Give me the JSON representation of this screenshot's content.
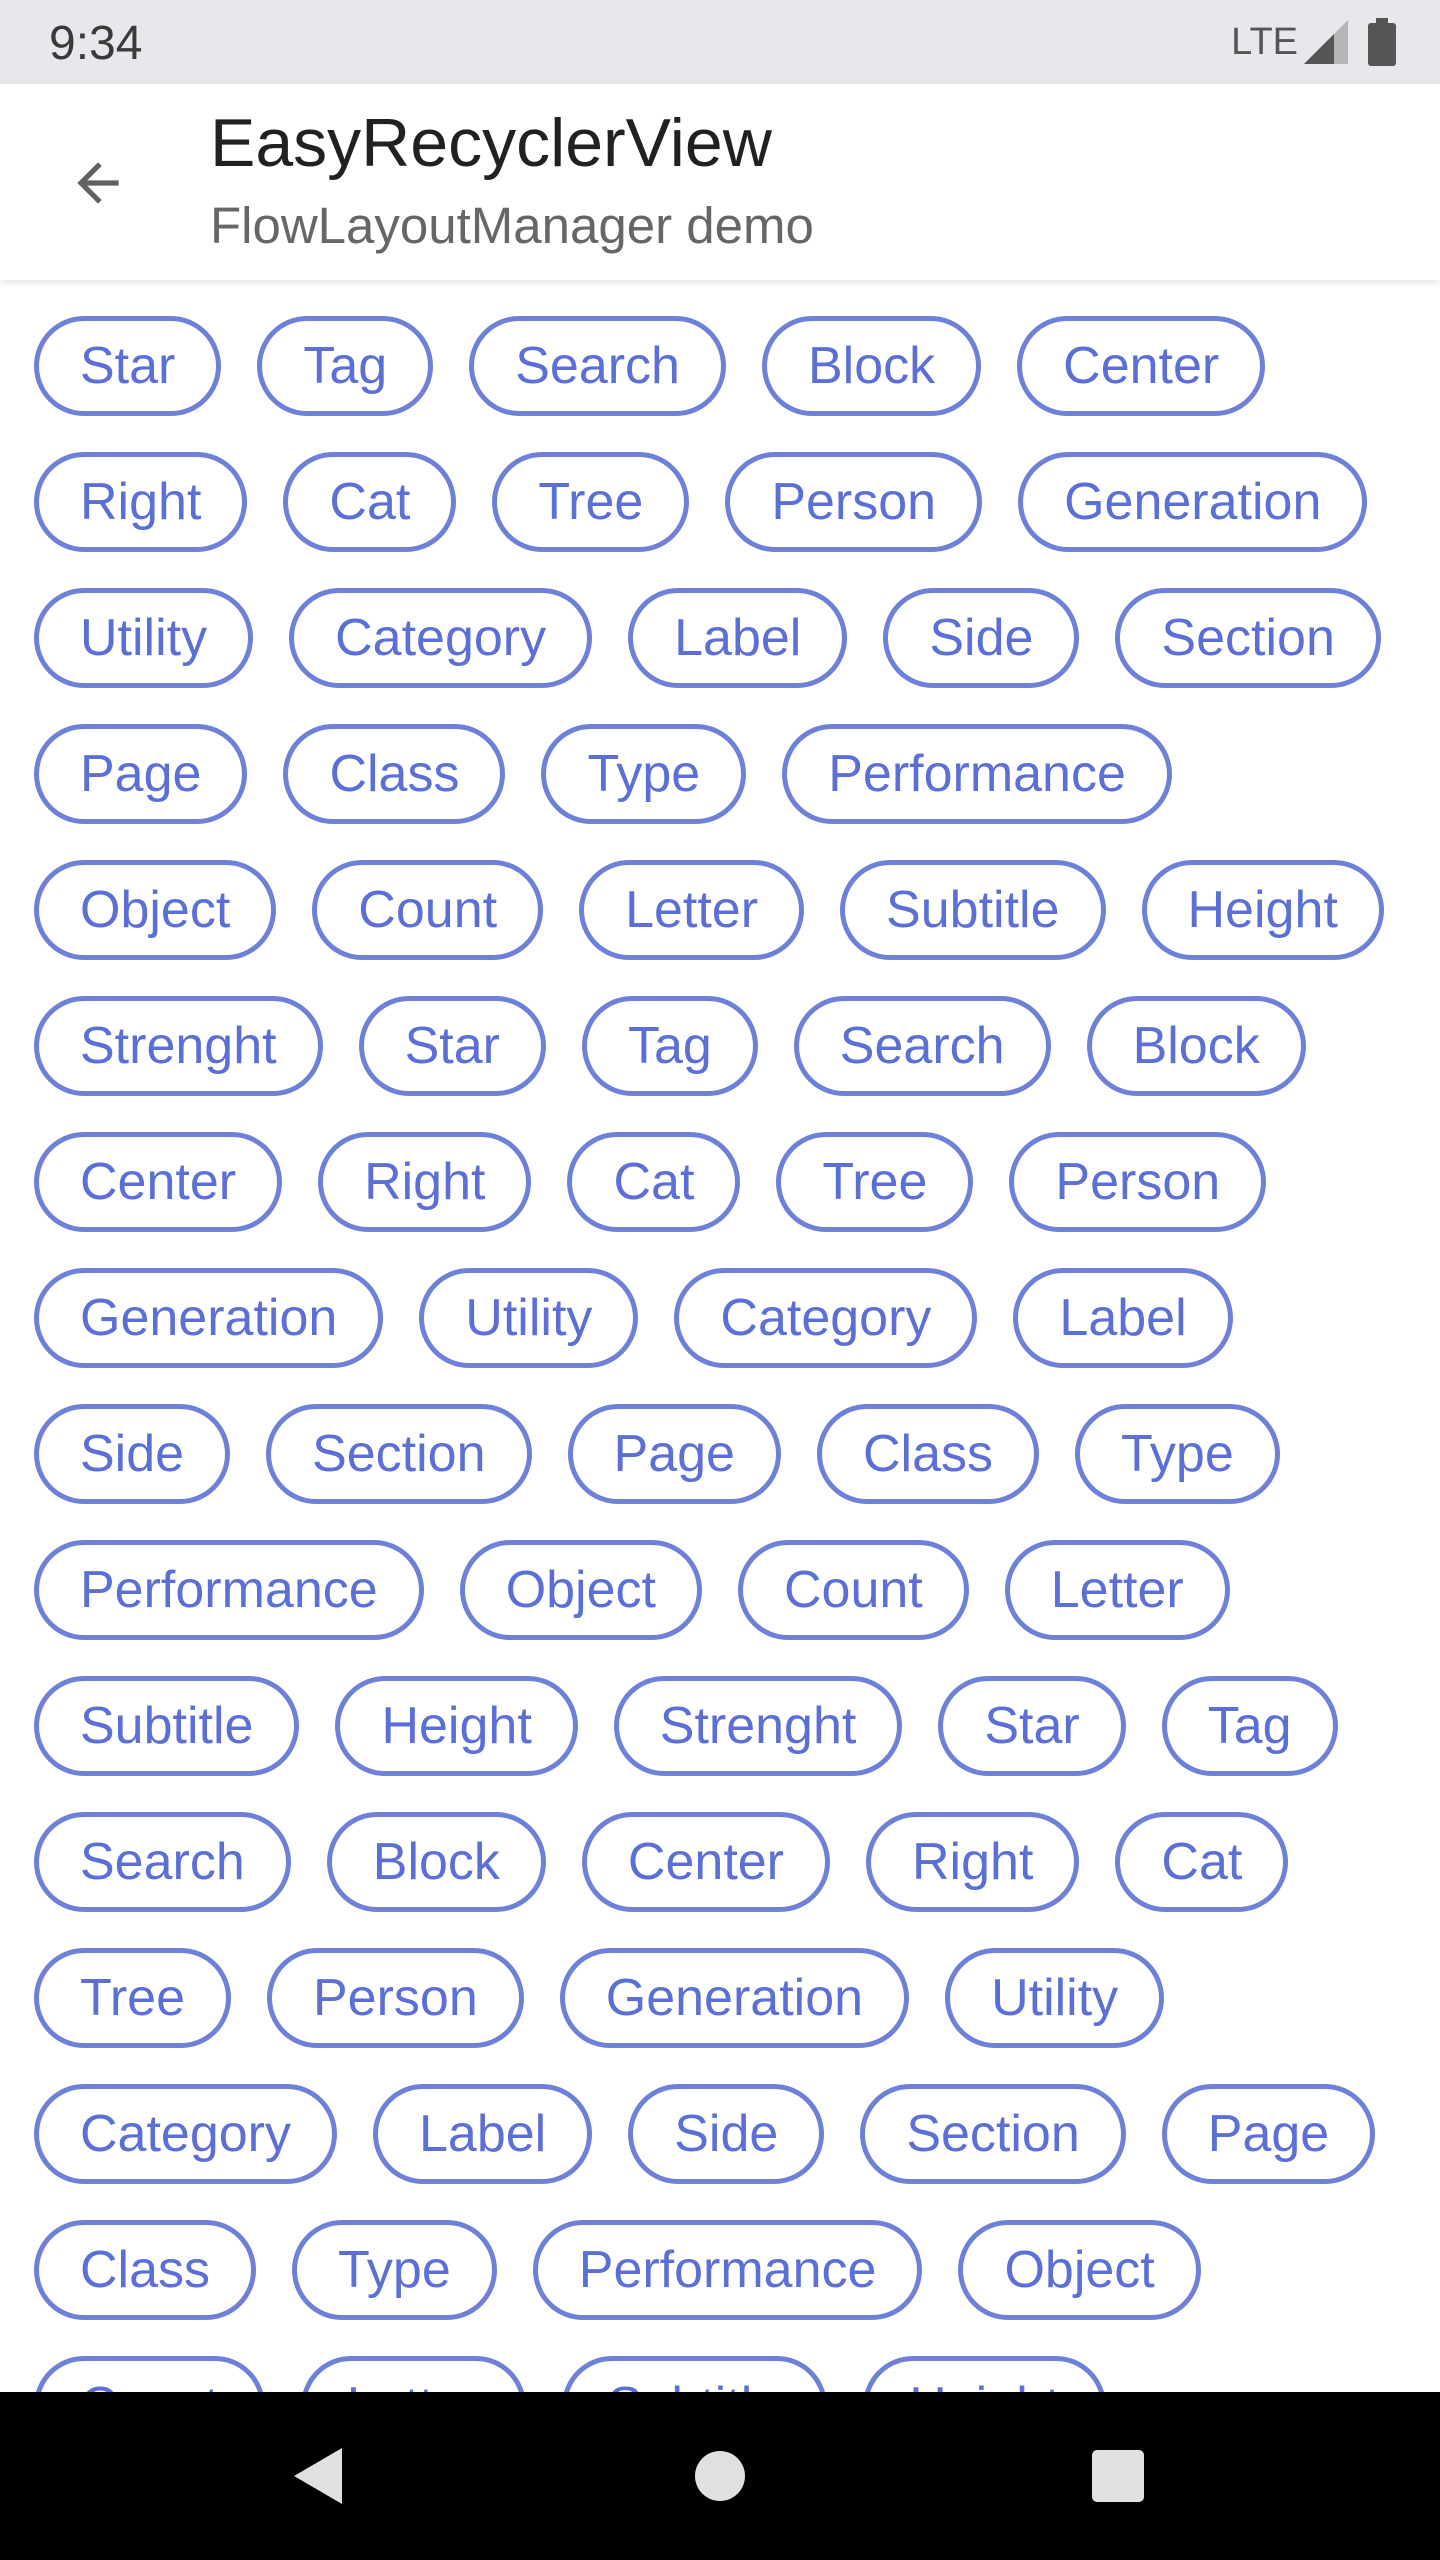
{
  "status_bar": {
    "time": "9:34",
    "network": "LTE"
  },
  "app_bar": {
    "title": "EasyRecyclerView",
    "subtitle": "FlowLayoutManager demo",
    "back_icon": "arrow-back-icon"
  },
  "colors": {
    "accent": "#5c6fd6",
    "tag_border": "#6f80d8",
    "status_bar_bg": "#e8e8ec",
    "nav_bar_bg": "#000000"
  },
  "tag_rows": [
    [
      "Star",
      "Tag",
      "Search",
      "Block",
      "Center"
    ],
    [
      "Right",
      "Cat",
      "Tree",
      "Person",
      "Generation"
    ],
    [
      "Utility",
      "Category",
      "Label",
      "Side",
      "Section"
    ],
    [
      "Page",
      "Class",
      "Type",
      "Performance"
    ],
    [
      "Object",
      "Count",
      "Letter",
      "Subtitle",
      "Height"
    ],
    [
      "Strenght",
      "Star",
      "Tag",
      "Search",
      "Block"
    ],
    [
      "Center",
      "Right",
      "Cat",
      "Tree",
      "Person"
    ],
    [
      "Generation",
      "Utility",
      "Category",
      "Label"
    ],
    [
      "Side",
      "Section",
      "Page",
      "Class",
      "Type"
    ],
    [
      "Performance",
      "Object",
      "Count",
      "Letter"
    ],
    [
      "Subtitle",
      "Height",
      "Strenght",
      "Star",
      "Tag"
    ],
    [
      "Search",
      "Block",
      "Center",
      "Right",
      "Cat"
    ],
    [
      "Tree",
      "Person",
      "Generation",
      "Utility"
    ],
    [
      "Category",
      "Label",
      "Side",
      "Section",
      "Page"
    ],
    [
      "Class",
      "Type",
      "Performance",
      "Object"
    ],
    [
      "Count",
      "Letter",
      "Subtitle",
      "Height"
    ]
  ],
  "nav_bar": {
    "icons": [
      "back-triangle-icon",
      "home-circle-icon",
      "recents-square-icon"
    ]
  }
}
